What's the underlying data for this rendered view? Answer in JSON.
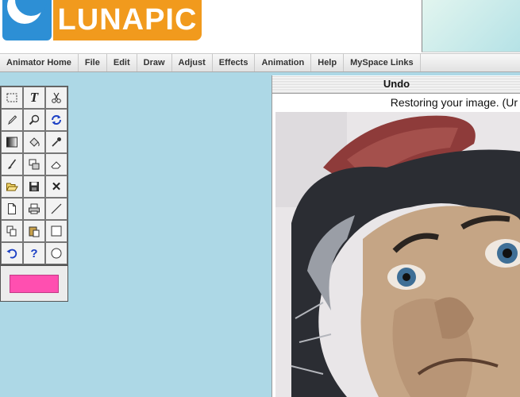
{
  "logo": {
    "text": "LUNAPIC"
  },
  "menu": [
    {
      "label": "Animator Home"
    },
    {
      "label": "File"
    },
    {
      "label": "Edit"
    },
    {
      "label": "Draw"
    },
    {
      "label": "Adjust"
    },
    {
      "label": "Effects"
    },
    {
      "label": "Animation"
    },
    {
      "label": "Help"
    },
    {
      "label": "MySpace Links"
    }
  ],
  "toolbox": {
    "tools": [
      "select-rectangle-icon",
      "text-tool-icon",
      "scissors-icon",
      "pencil-icon",
      "magnifier-icon",
      "rotate-icon",
      "gradient-icon",
      "paint-bucket-icon",
      "eyedropper-icon",
      "brush-icon",
      "crop-icon",
      "eraser-icon",
      "open-folder-icon",
      "save-icon",
      "close-icon",
      "new-file-icon",
      "print-icon",
      "line-tool-icon",
      "copy-icon",
      "paste-icon",
      "rectangle-tool-icon",
      "undo-icon",
      "help-icon",
      "ellipse-tool-icon"
    ],
    "current_color": "#ff4fb0",
    "tool_labels": {
      "text": "T",
      "help": "?",
      "close": "✕"
    }
  },
  "panel": {
    "title": "Undo",
    "status": "Restoring your image. (Ur"
  },
  "colors": {
    "logo_blue": "#2d8fd5",
    "logo_orange": "#f19a1d",
    "background": "#add8e6"
  }
}
